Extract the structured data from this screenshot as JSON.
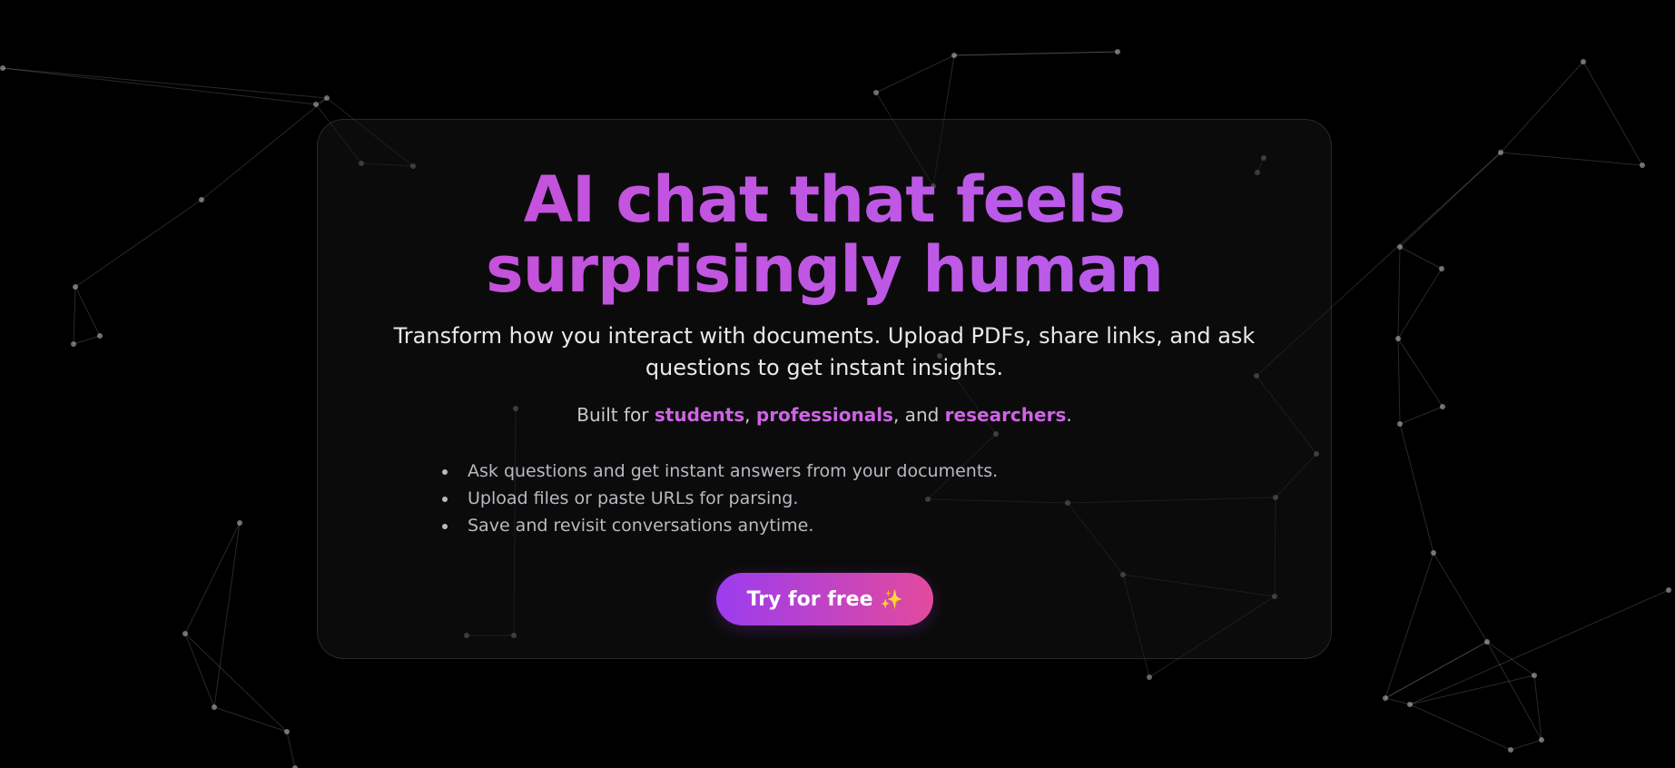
{
  "hero": {
    "headline_line1": "AI chat that feels",
    "headline_line2": "surprisingly human",
    "subtitle": "Transform how you interact with documents. Upload PDFs, share links, and ask questions to get instant insights.",
    "built_for": {
      "prefix": "Built for ",
      "audience_1": "students",
      "sep_1": ", ",
      "audience_2": "professionals",
      "sep_2": ", and ",
      "audience_3": "researchers",
      "suffix": "."
    },
    "features": [
      "Ask questions and get instant answers from your documents.",
      "Upload files or paste URLs for parsing.",
      "Save and revisit conversations anytime."
    ],
    "cta": {
      "label": "Try for free",
      "icon": "sparkles-icon",
      "icon_glyph": "✨"
    }
  },
  "colors": {
    "background": "#000000",
    "accent_text": "#cf63e6",
    "cta_gradient_start": "#9b3cf0",
    "cta_gradient_end": "#e34a9c"
  }
}
